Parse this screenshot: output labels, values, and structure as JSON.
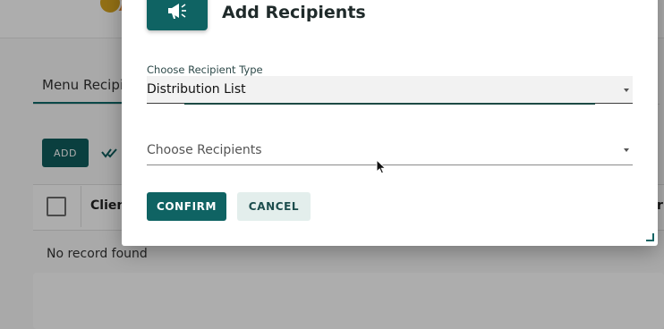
{
  "background": {
    "tab_label": "Menu Recipie",
    "add_button_label": "ADD",
    "table": {
      "column_client": "Client",
      "column_right_fragment": "r"
    },
    "empty_message": "No record found"
  },
  "dialog": {
    "icon": "megaphone-icon",
    "title": "Add Recipients",
    "recipient_type": {
      "label": "Choose Recipient Type",
      "value": "Distribution List"
    },
    "recipients": {
      "placeholder": "Choose Recipients",
      "value": ""
    },
    "confirm_label": "CONFIRM",
    "cancel_label": "CANCEL"
  },
  "colors": {
    "primary": "#0f6363",
    "secondary_button_bg": "#e3eeec",
    "overlay": "rgba(0,0,0,0.32)"
  }
}
